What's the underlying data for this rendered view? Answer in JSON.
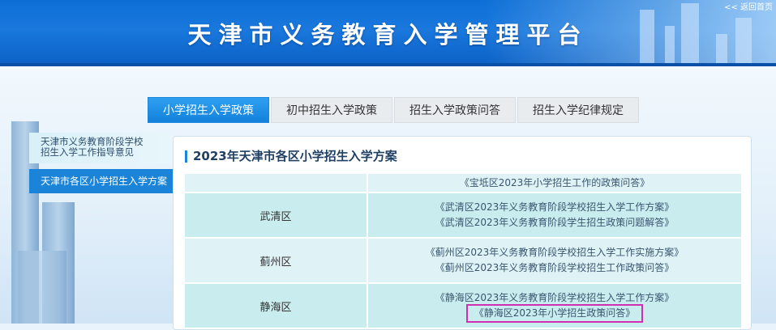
{
  "header": {
    "title": "天津市义务教育入学管理平台",
    "back_link": "<< 返回首页"
  },
  "tabs": [
    {
      "label": "小学招生入学政策",
      "active": true
    },
    {
      "label": "初中招生入学政策",
      "active": false
    },
    {
      "label": "招生入学政策问答",
      "active": false
    },
    {
      "label": "招生入学纪律规定",
      "active": false
    }
  ],
  "sidebar": {
    "items": [
      {
        "label": "天津市义务教育阶段学校招生入学工作指导意见",
        "line1": "天津市义务教育阶段学校",
        "line2": "招生入学工作指导意见",
        "active": false
      },
      {
        "label": "天津市各区小学招生入学方案",
        "active": true
      }
    ]
  },
  "content": {
    "title": "2023年天津市各区小学招生入学方案",
    "rows": [
      {
        "district": "",
        "links": [
          "《宝坻区2023年小学招生工作的政策问答》"
        ]
      },
      {
        "district": "武清区",
        "links": [
          "《武清区2023年义务教育阶段学校招生入学工作方案》",
          "《武清区2023年义务教育阶段学生招生政策问题解答》"
        ]
      },
      {
        "district": "蓟州区",
        "links": [
          "《蓟州区2023年义务教育阶段学校招生入学工作实施方案》",
          "《蓟州区2023年义务教育阶段学校招生工作政策问答》"
        ]
      },
      {
        "district": "静海区",
        "links": [
          "《静海区2023年义务教育阶段学校招生入学工作方案》",
          "《静海区2023年小学招生政策问答》"
        ]
      }
    ]
  },
  "colors": {
    "header_blue": "#0d6fd6",
    "tab_active": "#1482dc",
    "sidebar_active": "#1b84d8",
    "highlight_border": "#d02fb4"
  }
}
